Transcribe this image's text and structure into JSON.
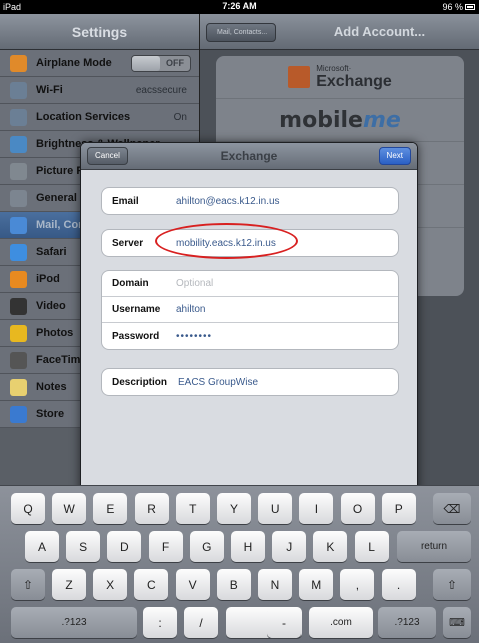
{
  "status": {
    "device": "iPad",
    "time": "7:26 AM",
    "battery": "96 %"
  },
  "settings": {
    "title": "Settings",
    "items": [
      {
        "label": "Airplane Mode",
        "value": "OFF",
        "toggle": true,
        "icon": "airplane-icon",
        "color": "#e08a2a"
      },
      {
        "label": "Wi-Fi",
        "value": "eacssecure",
        "icon": "wifi-icon",
        "color": "#6b7f95"
      },
      {
        "label": "Location Services",
        "value": "On",
        "icon": "location-icon",
        "color": "#6b7f95"
      },
      {
        "label": "Brightness & Wallpaper",
        "value": "",
        "icon": "brightness-icon",
        "color": "#4a89c4"
      },
      {
        "label": "Picture Frame",
        "value": "",
        "icon": "picture-frame-icon",
        "color": "#808890"
      },
      {
        "label": "General",
        "value": "",
        "icon": "gear-icon",
        "color": "#7c8590"
      },
      {
        "label": "Mail, Contacts, Calendars",
        "value": "",
        "icon": "mail-icon",
        "color": "#4a8ad6",
        "selected": true
      },
      {
        "label": "Safari",
        "value": "",
        "icon": "safari-icon",
        "color": "#3e8ee0"
      },
      {
        "label": "iPod",
        "value": "",
        "icon": "ipod-icon",
        "color": "#e88a20"
      },
      {
        "label": "Video",
        "value": "",
        "icon": "video-icon",
        "color": "#333"
      },
      {
        "label": "Photos",
        "value": "",
        "icon": "photos-icon",
        "color": "#e8b820"
      },
      {
        "label": "FaceTime",
        "value": "",
        "icon": "facetime-icon",
        "color": "#555"
      },
      {
        "label": "Notes",
        "value": "",
        "icon": "notes-icon",
        "color": "#e8d070"
      },
      {
        "label": "Store",
        "value": "",
        "icon": "store-icon",
        "color": "#3a7ad0"
      }
    ]
  },
  "right": {
    "back_label": "Mail, Contacts...",
    "title": "Add Account...",
    "ms_small": "Microsoft·",
    "ms_big": "Exchange",
    "mobileme_a": "mobile",
    "mobileme_b": "me"
  },
  "modal": {
    "cancel": "Cancel",
    "title": "Exchange",
    "next": "Next",
    "email_label": "Email",
    "email_value": "ahilton@eacs.k12.in.us",
    "server_label": "Server",
    "server_value": "mobility.eacs.k12.in.us",
    "domain_label": "Domain",
    "domain_placeholder": "Optional",
    "username_label": "Username",
    "username_value": "ahilton",
    "password_label": "Password",
    "password_value": "••••••••",
    "description_label": "Description",
    "description_value": "EACS GroupWise"
  },
  "keyboard": {
    "row1": [
      "Q",
      "W",
      "E",
      "R",
      "T",
      "Y",
      "U",
      "I",
      "O",
      "P"
    ],
    "row2": [
      "A",
      "S",
      "D",
      "F",
      "G",
      "H",
      "J",
      "K",
      "L"
    ],
    "row3": [
      "Z",
      "X",
      "C",
      "V",
      "B",
      "N",
      "M",
      ",",
      "."
    ],
    "return": "return",
    "num": ".?123",
    "colon": ":",
    "slash": "/",
    "dash": "-",
    "com": ".com"
  }
}
